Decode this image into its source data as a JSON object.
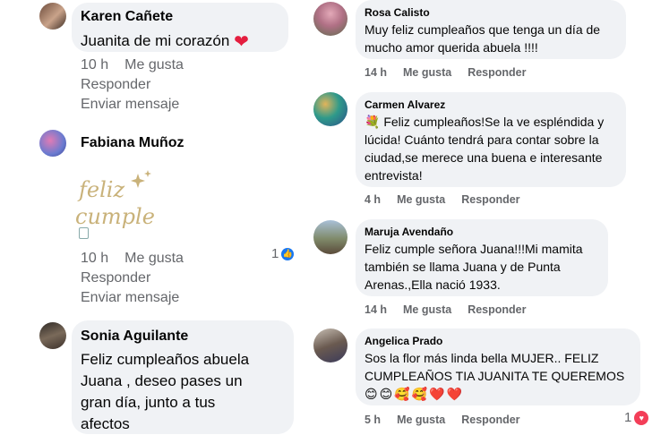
{
  "left": {
    "comments": [
      {
        "name": "Karen Cañete",
        "text": "Juanita  de mi corazón",
        "emoji": "❤",
        "time": "10 h",
        "like": "Me gusta",
        "reply": "Responder",
        "send": "Enviar mensaje"
      },
      {
        "name": "Fabiana Muñoz",
        "sticker_text_1": "feliz",
        "sticker_text_2": "cumple!",
        "time": "10 h",
        "like": "Me gusta",
        "reply": "Responder",
        "send": "Enviar mensaje",
        "reaction_count": "1",
        "reaction_icon": "like-icon"
      },
      {
        "name": "Sonia Aguilante",
        "text_lines": [
          "Feliz cumpleaños abuela",
          "Juana , deseo pases un",
          "gran día, junto a tus",
          "afectos"
        ]
      }
    ]
  },
  "right": {
    "comments": [
      {
        "name": "Rosa Calisto",
        "text_lines": [
          "Muy feliz cumpleaños que tenga un día de",
          "mucho amor querida abuela !!!!"
        ],
        "time": "14 h",
        "like": "Me gusta",
        "reply": "Responder"
      },
      {
        "name": "Carmen Alvarez",
        "text_lines": [
          "💐 Feliz cumpleaños!Se la ve espléndida y",
          "lúcida! Cuánto tendrá para contar sobre la",
          "ciudad,se merece una buena e interesante",
          "entrevista!"
        ],
        "time": "4 h",
        "like": "Me gusta",
        "reply": "Responder"
      },
      {
        "name": "Maruja Avendaño",
        "text_lines": [
          "Feliz cumple señora Juana!!!Mi mamita",
          "también se llama Juana y de Punta",
          "Arenas.,Ella nació 1933."
        ],
        "time": "14 h",
        "like": "Me gusta",
        "reply": "Responder"
      },
      {
        "name": "Angelica Prado",
        "text_lines": [
          "Sos la flor más linda bella MUJER.. FELIZ",
          "CUMPLEAÑOS TIA JUANITA TE QUEREMOS"
        ],
        "emojis": "😊😊🥰🥰❤️❤️",
        "time": "5 h",
        "like": "Me gusta",
        "reply": "Responder",
        "reaction_count": "1",
        "reaction_icon": "love-icon"
      }
    ]
  },
  "colors": {
    "bubble": "#f0f2f5",
    "meta": "#65676b",
    "like_blue": "#1877f2",
    "love_red": "#f33e58"
  }
}
